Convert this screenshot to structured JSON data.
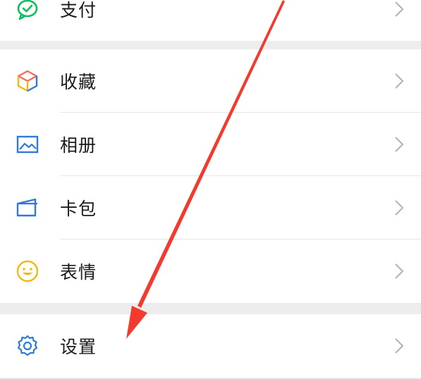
{
  "menu": {
    "groups": [
      {
        "items": [
          {
            "id": "pay",
            "label": "支付",
            "icon": "wechat-pay-icon"
          }
        ]
      },
      {
        "items": [
          {
            "id": "favorites",
            "label": "收藏",
            "icon": "cube-icon"
          },
          {
            "id": "album",
            "label": "相册",
            "icon": "image-icon"
          },
          {
            "id": "cards",
            "label": "卡包",
            "icon": "wallet-icon"
          },
          {
            "id": "stickers",
            "label": "表情",
            "icon": "smiley-icon"
          }
        ]
      },
      {
        "items": [
          {
            "id": "settings",
            "label": "设置",
            "icon": "gear-icon"
          }
        ]
      }
    ]
  },
  "colors": {
    "background": "#ededed",
    "row": "#ffffff",
    "text": "#1a1a1a",
    "chevron": "#b2b2b2",
    "pay_green": "#07c160",
    "blue": "#2f7ad9",
    "yellow": "#f5b80a",
    "annotation_red": "#f23a2f"
  }
}
